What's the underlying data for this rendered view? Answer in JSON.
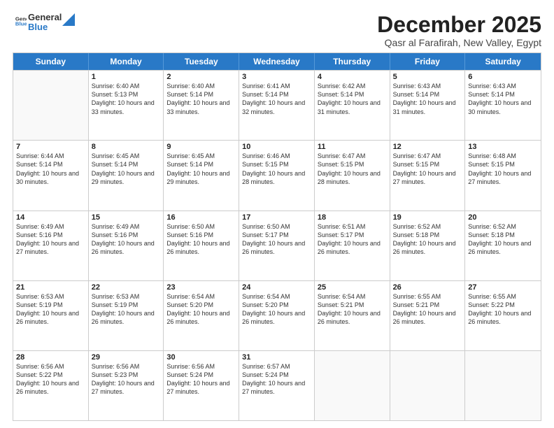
{
  "logo": {
    "line1": "General",
    "line2": "Blue"
  },
  "title": "December 2025",
  "location": "Qasr al Farafirah, New Valley, Egypt",
  "header_days": [
    "Sunday",
    "Monday",
    "Tuesday",
    "Wednesday",
    "Thursday",
    "Friday",
    "Saturday"
  ],
  "rows": [
    [
      {
        "day": "",
        "empty": true
      },
      {
        "day": "1",
        "sunrise": "Sunrise: 6:40 AM",
        "sunset": "Sunset: 5:13 PM",
        "daylight": "Daylight: 10 hours and 33 minutes."
      },
      {
        "day": "2",
        "sunrise": "Sunrise: 6:40 AM",
        "sunset": "Sunset: 5:14 PM",
        "daylight": "Daylight: 10 hours and 33 minutes."
      },
      {
        "day": "3",
        "sunrise": "Sunrise: 6:41 AM",
        "sunset": "Sunset: 5:14 PM",
        "daylight": "Daylight: 10 hours and 32 minutes."
      },
      {
        "day": "4",
        "sunrise": "Sunrise: 6:42 AM",
        "sunset": "Sunset: 5:14 PM",
        "daylight": "Daylight: 10 hours and 31 minutes."
      },
      {
        "day": "5",
        "sunrise": "Sunrise: 6:43 AM",
        "sunset": "Sunset: 5:14 PM",
        "daylight": "Daylight: 10 hours and 31 minutes."
      },
      {
        "day": "6",
        "sunrise": "Sunrise: 6:43 AM",
        "sunset": "Sunset: 5:14 PM",
        "daylight": "Daylight: 10 hours and 30 minutes."
      }
    ],
    [
      {
        "day": "7",
        "sunrise": "Sunrise: 6:44 AM",
        "sunset": "Sunset: 5:14 PM",
        "daylight": "Daylight: 10 hours and 30 minutes."
      },
      {
        "day": "8",
        "sunrise": "Sunrise: 6:45 AM",
        "sunset": "Sunset: 5:14 PM",
        "daylight": "Daylight: 10 hours and 29 minutes."
      },
      {
        "day": "9",
        "sunrise": "Sunrise: 6:45 AM",
        "sunset": "Sunset: 5:14 PM",
        "daylight": "Daylight: 10 hours and 29 minutes."
      },
      {
        "day": "10",
        "sunrise": "Sunrise: 6:46 AM",
        "sunset": "Sunset: 5:15 PM",
        "daylight": "Daylight: 10 hours and 28 minutes."
      },
      {
        "day": "11",
        "sunrise": "Sunrise: 6:47 AM",
        "sunset": "Sunset: 5:15 PM",
        "daylight": "Daylight: 10 hours and 28 minutes."
      },
      {
        "day": "12",
        "sunrise": "Sunrise: 6:47 AM",
        "sunset": "Sunset: 5:15 PM",
        "daylight": "Daylight: 10 hours and 27 minutes."
      },
      {
        "day": "13",
        "sunrise": "Sunrise: 6:48 AM",
        "sunset": "Sunset: 5:15 PM",
        "daylight": "Daylight: 10 hours and 27 minutes."
      }
    ],
    [
      {
        "day": "14",
        "sunrise": "Sunrise: 6:49 AM",
        "sunset": "Sunset: 5:16 PM",
        "daylight": "Daylight: 10 hours and 27 minutes."
      },
      {
        "day": "15",
        "sunrise": "Sunrise: 6:49 AM",
        "sunset": "Sunset: 5:16 PM",
        "daylight": "Daylight: 10 hours and 26 minutes."
      },
      {
        "day": "16",
        "sunrise": "Sunrise: 6:50 AM",
        "sunset": "Sunset: 5:16 PM",
        "daylight": "Daylight: 10 hours and 26 minutes."
      },
      {
        "day": "17",
        "sunrise": "Sunrise: 6:50 AM",
        "sunset": "Sunset: 5:17 PM",
        "daylight": "Daylight: 10 hours and 26 minutes."
      },
      {
        "day": "18",
        "sunrise": "Sunrise: 6:51 AM",
        "sunset": "Sunset: 5:17 PM",
        "daylight": "Daylight: 10 hours and 26 minutes."
      },
      {
        "day": "19",
        "sunrise": "Sunrise: 6:52 AM",
        "sunset": "Sunset: 5:18 PM",
        "daylight": "Daylight: 10 hours and 26 minutes."
      },
      {
        "day": "20",
        "sunrise": "Sunrise: 6:52 AM",
        "sunset": "Sunset: 5:18 PM",
        "daylight": "Daylight: 10 hours and 26 minutes."
      }
    ],
    [
      {
        "day": "21",
        "sunrise": "Sunrise: 6:53 AM",
        "sunset": "Sunset: 5:19 PM",
        "daylight": "Daylight: 10 hours and 26 minutes."
      },
      {
        "day": "22",
        "sunrise": "Sunrise: 6:53 AM",
        "sunset": "Sunset: 5:19 PM",
        "daylight": "Daylight: 10 hours and 26 minutes."
      },
      {
        "day": "23",
        "sunrise": "Sunrise: 6:54 AM",
        "sunset": "Sunset: 5:20 PM",
        "daylight": "Daylight: 10 hours and 26 minutes."
      },
      {
        "day": "24",
        "sunrise": "Sunrise: 6:54 AM",
        "sunset": "Sunset: 5:20 PM",
        "daylight": "Daylight: 10 hours and 26 minutes."
      },
      {
        "day": "25",
        "sunrise": "Sunrise: 6:54 AM",
        "sunset": "Sunset: 5:21 PM",
        "daylight": "Daylight: 10 hours and 26 minutes."
      },
      {
        "day": "26",
        "sunrise": "Sunrise: 6:55 AM",
        "sunset": "Sunset: 5:21 PM",
        "daylight": "Daylight: 10 hours and 26 minutes."
      },
      {
        "day": "27",
        "sunrise": "Sunrise: 6:55 AM",
        "sunset": "Sunset: 5:22 PM",
        "daylight": "Daylight: 10 hours and 26 minutes."
      }
    ],
    [
      {
        "day": "28",
        "sunrise": "Sunrise: 6:56 AM",
        "sunset": "Sunset: 5:22 PM",
        "daylight": "Daylight: 10 hours and 26 minutes."
      },
      {
        "day": "29",
        "sunrise": "Sunrise: 6:56 AM",
        "sunset": "Sunset: 5:23 PM",
        "daylight": "Daylight: 10 hours and 27 minutes."
      },
      {
        "day": "30",
        "sunrise": "Sunrise: 6:56 AM",
        "sunset": "Sunset: 5:24 PM",
        "daylight": "Daylight: 10 hours and 27 minutes."
      },
      {
        "day": "31",
        "sunrise": "Sunrise: 6:57 AM",
        "sunset": "Sunset: 5:24 PM",
        "daylight": "Daylight: 10 hours and 27 minutes."
      },
      {
        "day": "",
        "empty": true
      },
      {
        "day": "",
        "empty": true
      },
      {
        "day": "",
        "empty": true
      }
    ]
  ]
}
